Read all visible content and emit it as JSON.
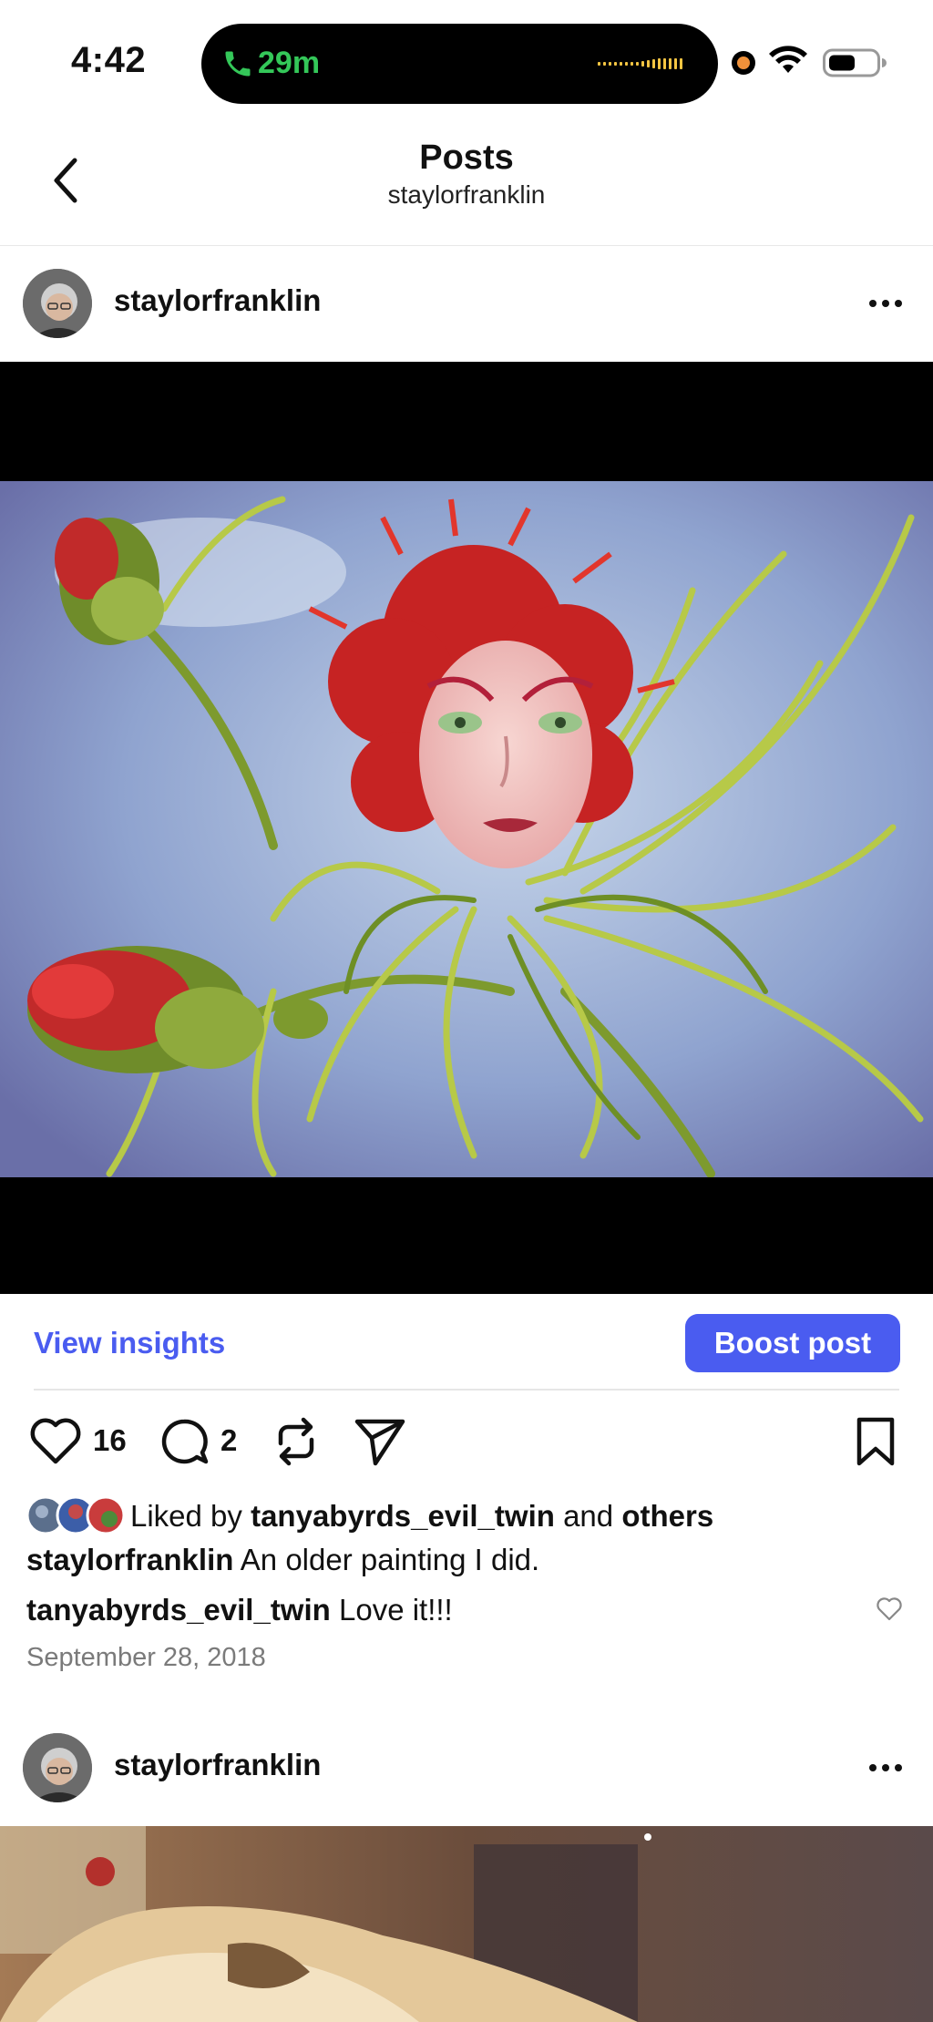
{
  "status_bar": {
    "time": "4:42",
    "call_duration": "29m",
    "call_color": "#34c759",
    "record_indicator_color": "#f0913a"
  },
  "nav": {
    "title": "Posts",
    "subtitle": "staylorfranklin",
    "back_icon": "chevron-left-icon"
  },
  "posts": [
    {
      "username": "staylorfranklin",
      "more_icon": "more-horizontal-icon",
      "insights_label": "View insights",
      "boost_label": "Boost post",
      "like_count": "16",
      "comment_count": "2",
      "liked_by_prefix": "Liked by",
      "liked_by_user": "tanyabyrds_evil_twin",
      "liked_by_and": "and",
      "liked_by_others": "others",
      "caption_user": "staylorfranklin",
      "caption_text": "An older painting I did.",
      "comment_user": "tanyabyrds_evil_twin",
      "comment_text": "Love it!!!",
      "date": "September 28, 2018"
    },
    {
      "username": "staylorfranklin",
      "more_icon": "more-horizontal-icon"
    }
  ],
  "accent_color": "#4a5cf0"
}
